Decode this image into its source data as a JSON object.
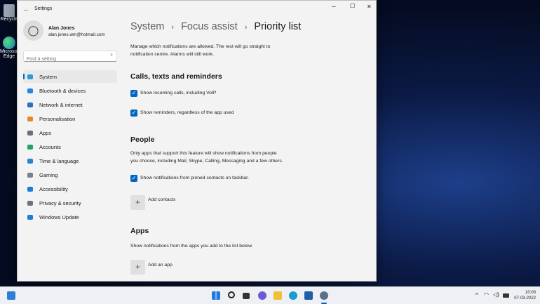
{
  "desktop": {
    "icons": [
      {
        "label": "Recycle"
      },
      {
        "label": "Microsoft Edge"
      }
    ]
  },
  "window": {
    "title": "Settings",
    "controls": {
      "minimize": "─",
      "maximize": "☐",
      "close": "✕"
    }
  },
  "user": {
    "name": "Alan Jones",
    "email": "alan.jones.wm@hotmail.com"
  },
  "search": {
    "placeholder": "Find a setting"
  },
  "sidebar": {
    "items": [
      {
        "label": "System",
        "icon": "monitor-icon",
        "color": "#2b9bd8",
        "selected": true
      },
      {
        "label": "Bluetooth & devices",
        "icon": "bluetooth-icon",
        "color": "#1e88e5"
      },
      {
        "label": "Network & internet",
        "icon": "wifi-icon",
        "color": "#2d6fb8"
      },
      {
        "label": "Personalisation",
        "icon": "brush-icon",
        "color": "#e08a2c"
      },
      {
        "label": "Apps",
        "icon": "apps-icon",
        "color": "#6b6f7a"
      },
      {
        "label": "Accounts",
        "icon": "person-icon",
        "color": "#26a269"
      },
      {
        "label": "Time & language",
        "icon": "globe-clock-icon",
        "color": "#2f80c8"
      },
      {
        "label": "Gaming",
        "icon": "controller-icon",
        "color": "#7a7f88"
      },
      {
        "label": "Accessibility",
        "icon": "accessibility-icon",
        "color": "#1f7ad1"
      },
      {
        "label": "Privacy & security",
        "icon": "shield-icon",
        "color": "#6b7280"
      },
      {
        "label": "Windows Update",
        "icon": "update-icon",
        "color": "#1f7ad1"
      }
    ]
  },
  "breadcrumb": {
    "items": [
      "System",
      "Focus assist"
    ],
    "current": "Priority list",
    "separator": "›"
  },
  "main": {
    "description_1": "Manage which notifications are allowed. The rest will go straight to",
    "description_2": "notification centre. Alarms will still work.",
    "calls": {
      "heading": "Calls, texts and reminders",
      "options": [
        {
          "label": "Show incoming calls, including VoIP",
          "checked": true
        },
        {
          "label": "Show reminders, regardless of the app used",
          "checked": true
        }
      ]
    },
    "people": {
      "heading": "People",
      "text_1": "Only apps that support this feature will show notifications from people",
      "text_2": "you choose, including Mail, Skype, Calling, Messaging and a few others.",
      "option": {
        "label": "Show notifications from pinned contacts on taskbar.",
        "checked": true
      },
      "add_label": "Add contacts"
    },
    "apps": {
      "heading": "Apps",
      "text": "Show notifications from the apps you add to the list below.",
      "add_label": "Add an app"
    }
  },
  "taskbar": {
    "time": "10:00",
    "date": "07-03-2022"
  }
}
